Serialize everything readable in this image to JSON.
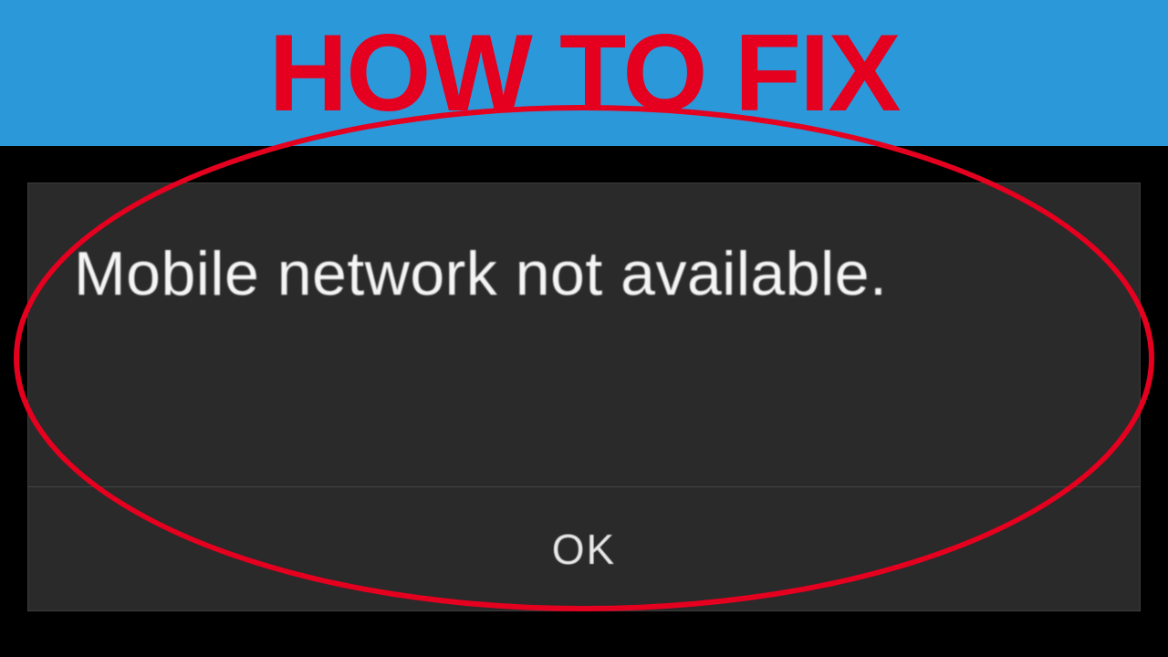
{
  "header": {
    "title": "HOW TO FIX"
  },
  "dialog": {
    "message": "Mobile network not available.",
    "button_label": "OK"
  },
  "colors": {
    "header_bg": "#2b98da",
    "accent_red": "#e6001f",
    "dialog_bg": "#2a2a2a"
  }
}
